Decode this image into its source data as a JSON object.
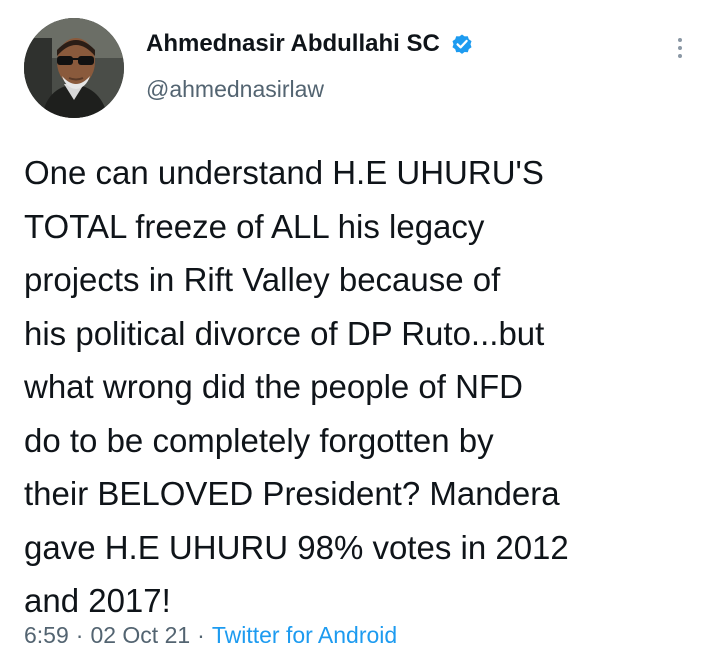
{
  "tweet": {
    "author": {
      "display_name": "Ahmednasir Abdullahi SC",
      "handle": "@ahmednasirlaw",
      "verified_icon": "verified-badge-icon",
      "avatar_icon": "profile-photo"
    },
    "more_icon": "more-options-icon",
    "text_lines": [
      "One can understand H.E UHURU'S",
      "TOTAL freeze of ALL his legacy",
      "projects in Rift Valley because of",
      "his political divorce of DP Ruto...but",
      "what wrong did the people of NFD",
      "do to be completely forgotten by",
      "their BELOVED President? Mandera",
      "gave H.E UHURU 98% votes in 2012",
      "and 2017!"
    ],
    "time": "6:59",
    "separator": "·",
    "date": "02 Oct 21",
    "source": "Twitter for Android"
  },
  "colors": {
    "text_primary": "#0f1419",
    "text_secondary": "#536471",
    "link": "#1d9bf0",
    "verified": "#1d9bf0"
  }
}
